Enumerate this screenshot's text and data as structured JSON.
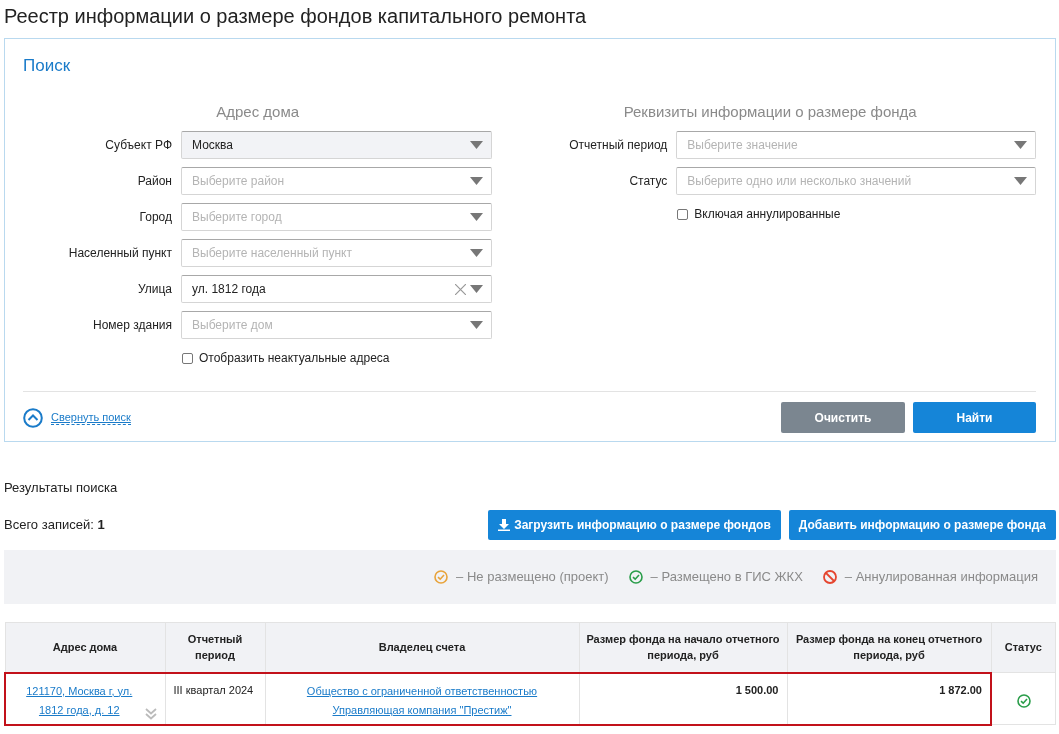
{
  "page_title": "Реестр информации о размере фондов капитального ремонта",
  "search": {
    "title": "Поиск",
    "address": {
      "heading": "Адрес дома",
      "fields": [
        {
          "label": "Субъект РФ",
          "value": "Москва",
          "disabled": true,
          "clearable": false
        },
        {
          "label": "Район",
          "placeholder": "Выберите район",
          "disabled": false,
          "clearable": false
        },
        {
          "label": "Город",
          "placeholder": "Выберите город",
          "disabled": false,
          "clearable": false
        },
        {
          "label": "Населенный пункт",
          "placeholder": "Выберите населенный пункт",
          "disabled": false,
          "clearable": false
        },
        {
          "label": "Улица",
          "value": "ул. 1812 года",
          "disabled": false,
          "clearable": true
        },
        {
          "label": "Номер здания",
          "placeholder": "Выберите дом",
          "disabled": false,
          "clearable": false
        }
      ],
      "checkbox": {
        "label": "Отобразить неактуальные адреса",
        "checked": false
      }
    },
    "details": {
      "heading": "Реквизиты информации о размере фонда",
      "fields": [
        {
          "label": "Отчетный период",
          "placeholder": "Выберите значение",
          "disabled": false,
          "clearable": false
        },
        {
          "label": "Статус",
          "placeholder": "Выберите одно или несколько значений",
          "disabled": false,
          "clearable": false
        }
      ],
      "checkbox": {
        "label": "Включая аннулированные",
        "checked": false
      }
    },
    "collapse_link": "Свернуть поиск",
    "clear_button": "Очистить",
    "find_button": "Найти"
  },
  "results": {
    "title": "Результаты поиска",
    "total_label": "Всего записей:",
    "total": "1",
    "upload_button": "Загрузить информацию о размере фондов",
    "add_button": "Добавить информацию о размере фонда",
    "legend": [
      {
        "kind": "check",
        "color": "#e8a33a",
        "label": "–  Не размещено (проект)"
      },
      {
        "kind": "check",
        "color": "#2a9d4a",
        "label": "–  Размещено в ГИС ЖКХ"
      },
      {
        "kind": "cancel",
        "color": "#e5452f",
        "label": "–  Аннулированная информация"
      }
    ],
    "columns": [
      "Адрес дома",
      "Отчетный период",
      "Владелец счета",
      "Размер фонда на начало отчетного периода, руб",
      "Размер фонда на конец отчетного периода, руб",
      "Статус"
    ],
    "rows": [
      {
        "selected": true,
        "address": "121170, Москва г, ул. 1812 года, д. 12",
        "period": "III квартал 2024",
        "owner": "Общество с ограниченной ответственностью Управляющая компания \"Престиж\"",
        "start": "1 500.00",
        "end": "1 872.00",
        "status_icon": {
          "kind": "check",
          "color": "#2a9d4a"
        }
      }
    ]
  }
}
